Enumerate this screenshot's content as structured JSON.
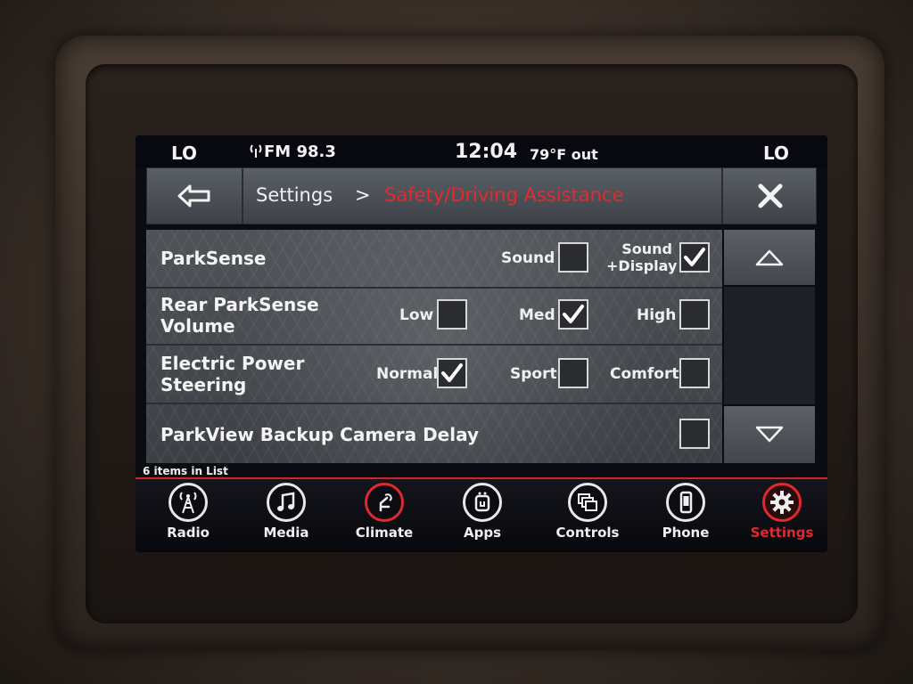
{
  "status_bar": {
    "climate_left": "LO",
    "radio": "FM 98.3",
    "time": "12:04",
    "outside_temp": "79°F out",
    "climate_right": "LO"
  },
  "header": {
    "breadcrumb_root": "Settings",
    "separator": ">",
    "current": "Safety/Driving Assistance"
  },
  "list": {
    "rows": [
      {
        "title": "ParkSense",
        "options": [
          {
            "label": "Sound",
            "checked": false
          },
          {
            "label": "Sound +Display",
            "checked": true
          }
        ]
      },
      {
        "title": "Rear ParkSense Volume",
        "options": [
          {
            "label": "Low",
            "checked": false
          },
          {
            "label": "Med",
            "checked": true
          },
          {
            "label": "High",
            "checked": false
          }
        ]
      },
      {
        "title": "Electric Power Steering",
        "options": [
          {
            "label": "Normal",
            "checked": true
          },
          {
            "label": "Sport",
            "checked": false
          },
          {
            "label": "Comfort",
            "checked": false
          }
        ]
      },
      {
        "title": "ParkView Backup Camera Delay",
        "options": [
          {
            "label": "",
            "checked": false
          }
        ]
      }
    ],
    "items_count": "6 items in List"
  },
  "nav": {
    "items": [
      {
        "label": "Radio",
        "icon": "radio-tower-icon",
        "active": false
      },
      {
        "label": "Media",
        "icon": "music-note-icon",
        "active": false
      },
      {
        "label": "Climate",
        "icon": "climate-seat-icon",
        "active": false
      },
      {
        "label": "Apps",
        "icon": "apps-icon",
        "active": false
      },
      {
        "label": "Controls",
        "icon": "controls-icon",
        "active": false
      },
      {
        "label": "Phone",
        "icon": "phone-icon",
        "active": false
      },
      {
        "label": "Settings",
        "icon": "gear-icon",
        "active": true
      }
    ]
  },
  "colors": {
    "accent_red": "#e8282d",
    "text": "#f4f4f4"
  }
}
